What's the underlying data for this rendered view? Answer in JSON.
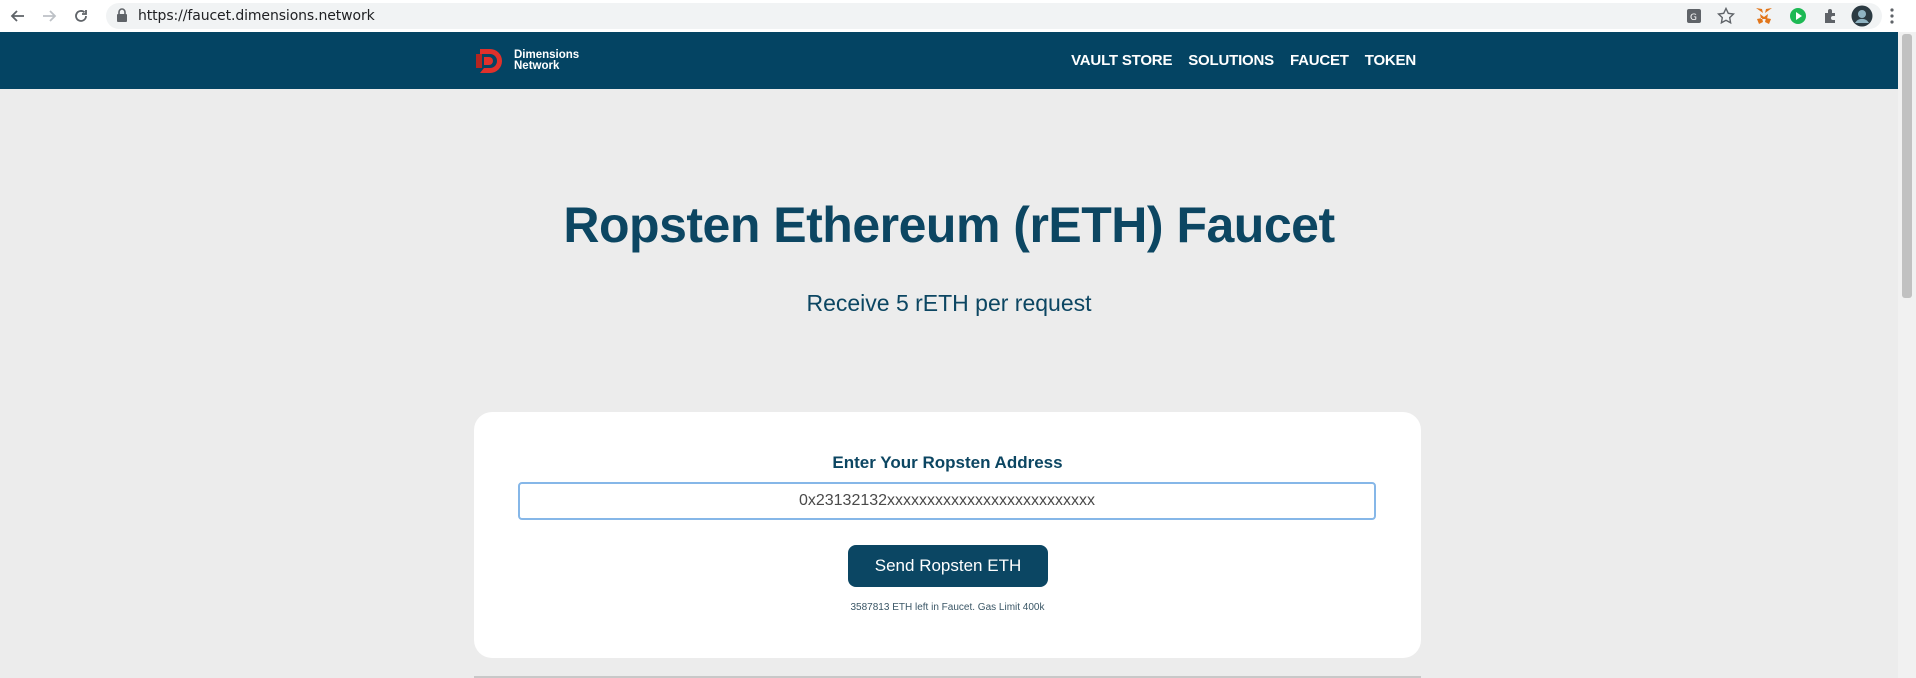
{
  "browser": {
    "url": "https://faucet.dimensions.network"
  },
  "nav": {
    "logo_line1": "Dimensions",
    "logo_line2": "Network",
    "links": [
      "VAULT STORE",
      "SOLUTIONS",
      "FAUCET",
      "TOKEN"
    ]
  },
  "hero": {
    "title": "Ropsten Ethereum (rETH) Faucet",
    "subtitle": "Receive 5 rETH per request"
  },
  "form": {
    "label": "Enter Your Ropsten Address",
    "address_value": "0x23132132xxxxxxxxxxxxxxxxxxxxxxxxxx",
    "button_label": "Send Ropsten ETH",
    "footnote": "3587813 ETH left in Faucet. Gas Limit 400k"
  },
  "colors": {
    "nav_bg": "#044463",
    "accent": "#0c4662",
    "logo_red": "#e0312b"
  }
}
